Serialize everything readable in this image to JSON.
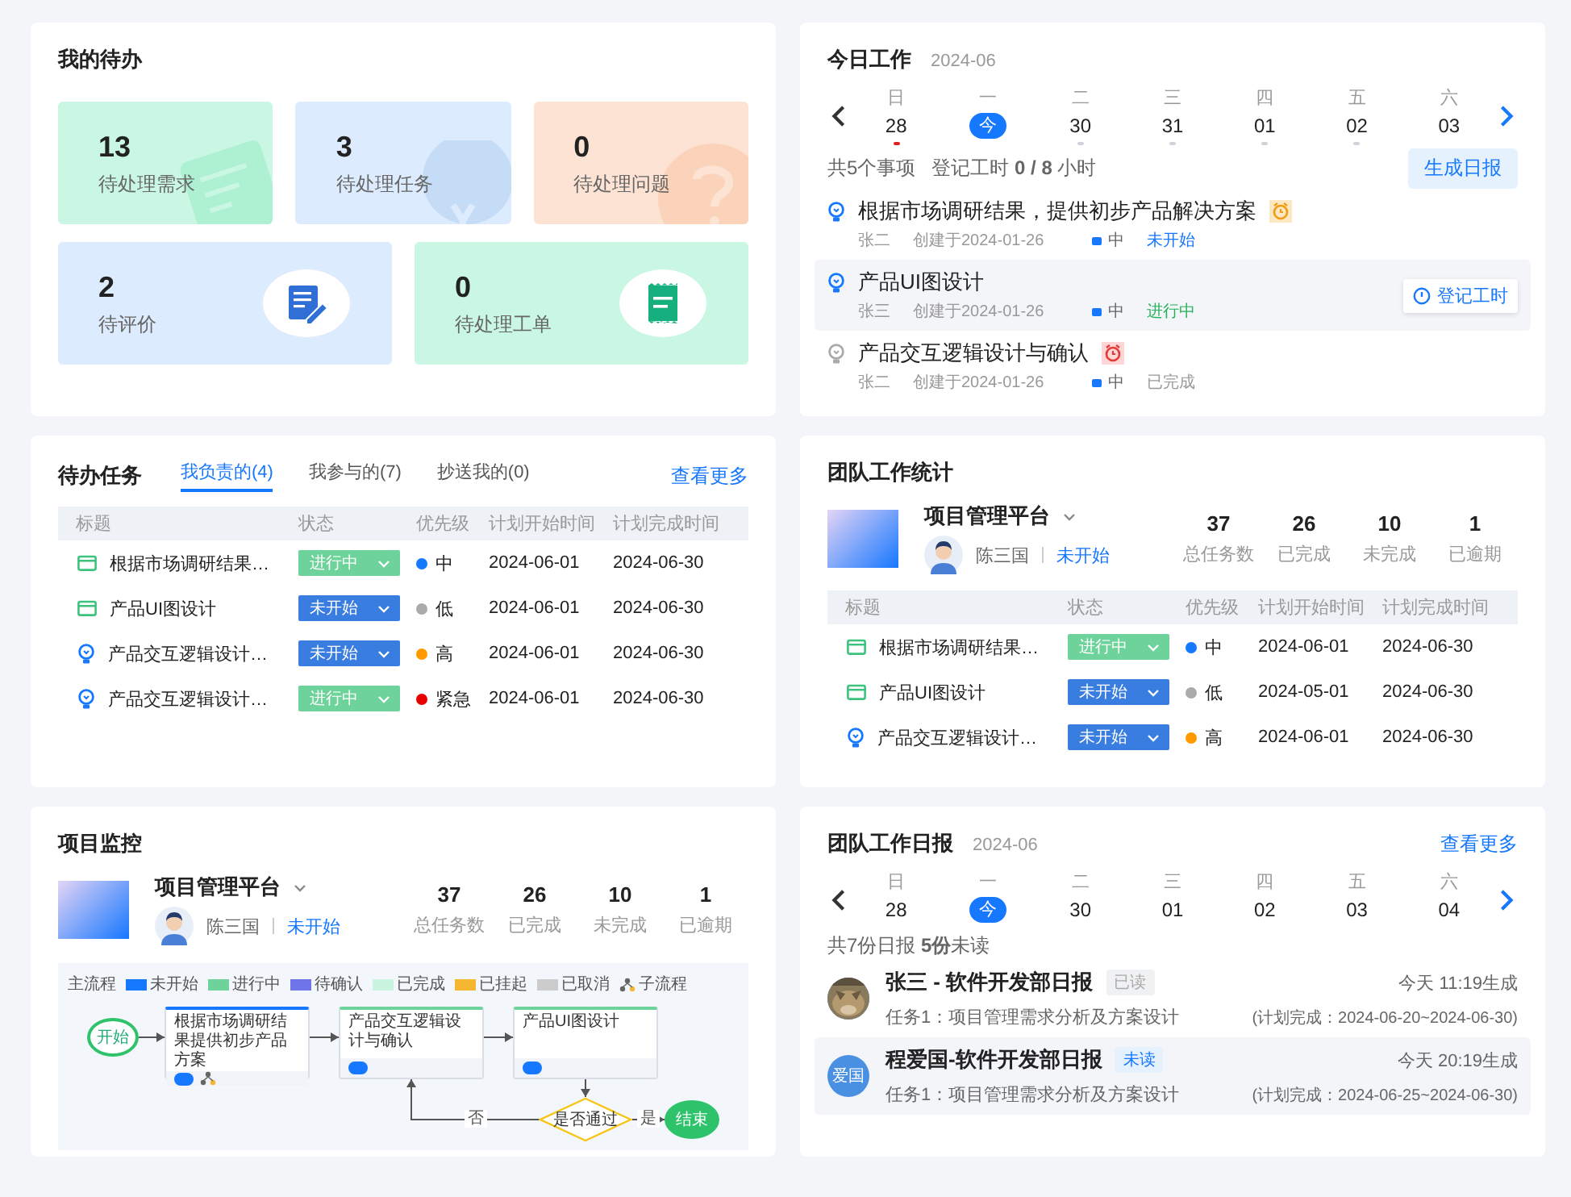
{
  "todo": {
    "title": "我的待办",
    "tiles": [
      {
        "kind": "requirement",
        "count": "13",
        "label": "待处理需求"
      },
      {
        "kind": "task",
        "count": "3",
        "label": "待处理任务"
      },
      {
        "kind": "issue",
        "count": "0",
        "label": "待处理问题"
      },
      {
        "kind": "review",
        "count": "2",
        "label": "待评价"
      },
      {
        "kind": "ticket",
        "count": "0",
        "label": "待处理工单"
      }
    ]
  },
  "today": {
    "title": "今日工作",
    "month": "2024-06",
    "days": [
      {
        "weekday": "日",
        "date": "28",
        "selected": false,
        "color": "#e02020"
      },
      {
        "weekday": "一",
        "date": "今",
        "selected": true
      },
      {
        "weekday": "二",
        "date": "30",
        "selected": false,
        "color": "#d0d4da"
      },
      {
        "weekday": "三",
        "date": "31",
        "selected": false,
        "color": "#d0d4da"
      },
      {
        "weekday": "四",
        "date": "01",
        "selected": false,
        "color": "#d0d4da"
      },
      {
        "weekday": "五",
        "date": "02",
        "selected": false,
        "color": "#d0d4da"
      },
      {
        "weekday": "六",
        "date": "03",
        "selected": false
      }
    ],
    "summary": "共5个事项",
    "hours": "登记工时 **0 / 8** 小时",
    "report_button": "生成日报",
    "items": [
      {
        "title": "根据市场调研结果，提供初步产品解决方案",
        "alarm": {
          "kind": "warning"
        },
        "owner": "张二",
        "created": "创建于2024-01-26",
        "priority": {
          "label": "中",
          "color": "#1677ff"
        },
        "status": {
          "label": "未开始",
          "kind": "not_started"
        },
        "selected": false
      },
      {
        "title": "产品UI图设计",
        "owner": "张三",
        "created": "创建于2024-01-26",
        "priority": {
          "label": "中",
          "color": "#1677ff"
        },
        "status": {
          "label": "进行中",
          "kind": "in_progress"
        },
        "selected": true,
        "action": "登记工时"
      },
      {
        "title": "产品交互逻辑设计与确认",
        "alarm": {
          "kind": "overdue"
        },
        "owner": "张二",
        "created": "创建于2024-01-26",
        "priority": {
          "label": "中",
          "color": "#1677ff"
        },
        "status": {
          "label": "已完成",
          "kind": "done"
        },
        "selected": false
      }
    ]
  },
  "tasks": {
    "title": "待办任务",
    "tabs": [
      {
        "label": "我负责的(4)",
        "selected": true
      },
      {
        "label": "我参与的(7)",
        "selected": false
      },
      {
        "label": "抄送我的(0)",
        "selected": false
      }
    ],
    "more": "查看更多",
    "columns": [
      "标题",
      "状态",
      "优先级",
      "计划开始时间",
      "计划完成时间"
    ],
    "rows": [
      {
        "kind": "folder",
        "title": "根据市场调研结果…",
        "status": {
          "label": "进行中",
          "kind": "in_progress"
        },
        "priority": {
          "label": "中",
          "color": "#1677ff"
        },
        "start": "2024-06-01",
        "end": "2024-06-30"
      },
      {
        "kind": "folder",
        "title": "产品UI图设计",
        "status": {
          "label": "未开始",
          "kind": "not_started"
        },
        "priority": {
          "label": "低",
          "color": "#aaaaaa"
        },
        "start": "2024-06-01",
        "end": "2024-06-30"
      },
      {
        "kind": "bulb",
        "title": "产品交互逻辑设计…",
        "status": {
          "label": "未开始",
          "kind": "not_started"
        },
        "priority": {
          "label": "高",
          "color": "#ff9900"
        },
        "start": "2024-06-01",
        "end": "2024-06-30"
      },
      {
        "kind": "bulb",
        "title": "产品交互逻辑设计…",
        "status": {
          "label": "进行中",
          "kind": "in_progress"
        },
        "priority": {
          "label": "紧急",
          "color": "#e60000"
        },
        "start": "2024-06-01",
        "end": "2024-06-30"
      }
    ]
  },
  "team": {
    "title": "团队工作统计",
    "project": {
      "name": "项目管理平台",
      "owner": "陈三国",
      "status": "未开始",
      "stats": [
        {
          "value": "37",
          "label": "总任务数"
        },
        {
          "value": "26",
          "label": "已完成"
        },
        {
          "value": "10",
          "label": "未完成"
        },
        {
          "value": "1",
          "label": "已逾期"
        }
      ]
    },
    "columns": [
      "标题",
      "状态",
      "优先级",
      "计划开始时间",
      "计划完成时间"
    ],
    "rows": [
      {
        "kind": "folder",
        "title": "根据市场调研结果…",
        "status": {
          "label": "进行中",
          "kind": "in_progress"
        },
        "priority": {
          "label": "中",
          "color": "#1677ff"
        },
        "start": "2024-06-01",
        "end": "2024-06-30"
      },
      {
        "kind": "folder",
        "title": "产品UI图设计",
        "status": {
          "label": "未开始",
          "kind": "not_started"
        },
        "priority": {
          "label": "低",
          "color": "#aaaaaa"
        },
        "start": "2024-05-01",
        "end": "2024-06-30"
      },
      {
        "kind": "bulb",
        "title": "产品交互逻辑设计…",
        "status": {
          "label": "未开始",
          "kind": "not_started"
        },
        "priority": {
          "label": "高",
          "color": "#ff9900"
        },
        "start": "2024-06-01",
        "end": "2024-06-30"
      }
    ]
  },
  "monitor": {
    "title": "项目监控",
    "project": {
      "name": "项目管理平台",
      "owner": "陈三国",
      "status": "未开始",
      "stats": [
        {
          "value": "37",
          "label": "总任务数"
        },
        {
          "value": "26",
          "label": "已完成"
        },
        {
          "value": "10",
          "label": "未完成"
        },
        {
          "value": "1",
          "label": "已逾期"
        }
      ]
    },
    "flow": {
      "legend_title": "主流程",
      "legend": [
        {
          "kind": "swatch",
          "label": "未开始",
          "color": "#1677ff"
        },
        {
          "kind": "swatch",
          "label": "进行中",
          "color": "#6dd39a"
        },
        {
          "kind": "swatch",
          "label": "待确认",
          "color": "#6f74e8"
        },
        {
          "kind": "swatch",
          "label": "已完成",
          "color": "#c9f5e0"
        },
        {
          "kind": "swatch",
          "label": "已挂起",
          "color": "#f5b731"
        },
        {
          "kind": "swatch",
          "label": "已取消",
          "color": "#cccccc"
        },
        {
          "kind": "subprocess",
          "label": "子流程"
        }
      ],
      "start": "开始",
      "nodes": [
        {
          "title": "根据市场调研结果提供初步产品方案",
          "color": "#1677ff",
          "subprocess": true
        },
        {
          "title": "产品交互逻辑设计与确认",
          "color": "#6dd39a",
          "subprocess": false
        },
        {
          "title": "产品UI图设计",
          "color": "#6dd39a",
          "subprocess": false
        }
      ],
      "decision": "是否通过",
      "no": "否",
      "yes": "是",
      "end": "结束"
    }
  },
  "reports": {
    "title": "团队工作日报",
    "month": "2024-06",
    "more": "查看更多",
    "days": [
      {
        "weekday": "日",
        "date": "28",
        "selected": false
      },
      {
        "weekday": "一",
        "date": "今",
        "selected": true
      },
      {
        "weekday": "二",
        "date": "30",
        "selected": false
      },
      {
        "weekday": "三",
        "date": "01",
        "selected": false
      },
      {
        "weekday": "四",
        "date": "02",
        "selected": false
      },
      {
        "weekday": "五",
        "date": "03",
        "selected": false
      },
      {
        "weekday": "六",
        "date": "04",
        "selected": false
      }
    ],
    "summary": "共7份日报 **5份**未读",
    "items": [
      {
        "title": "张三 - 软件开发部日报",
        "read": true,
        "badge": "已读",
        "time": "今天 11:19生成",
        "task": "任务1：项目管理需求分析及方案设计",
        "plan": "(计划完成：2024-06-20~2024-06-30)",
        "selected": false
      },
      {
        "avatar": {
          "kind": "initials",
          "text": "爱国"
        },
        "title": "程爱国-软件开发部日报",
        "read": false,
        "badge": "未读",
        "time": "今天 20:19生成",
        "task": "任务1：项目管理需求分析及方案设计",
        "plan": "(计划完成：2024-06-25~2024-06-30)",
        "selected": true
      }
    ]
  }
}
